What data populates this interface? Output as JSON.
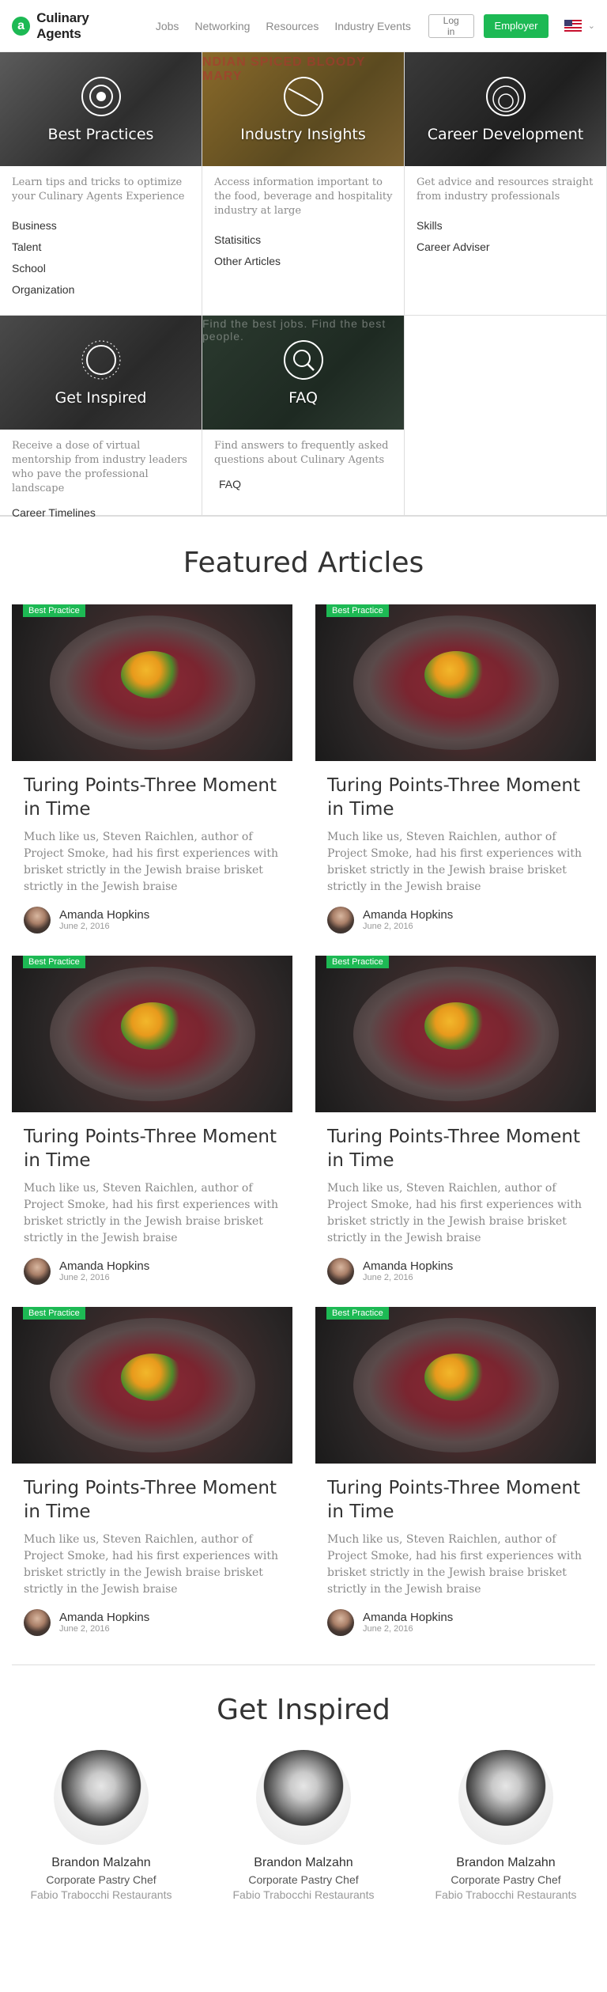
{
  "header": {
    "logo_text": "Culinary Agents",
    "nav": [
      "Jobs",
      "Networking",
      "Resources",
      "Industry Events"
    ],
    "login_label": "Log in",
    "employer_label": "Employer",
    "accent_color": "#1db954"
  },
  "categories": [
    {
      "title": "Best Practices",
      "tile_text": "",
      "description": "Learn tips and tricks to optimize your Culinary Agents Experience",
      "links": [
        "Business",
        "Talent",
        "School",
        "Organization"
      ]
    },
    {
      "title": "Industry Insights",
      "tile_text": "NDIAN SPICED   BLOODY MARY",
      "description": "Access information important to the food, beverage and hospitality industry at large",
      "links": [
        "Statisitics",
        "Other Articles"
      ]
    },
    {
      "title": "Career Development",
      "tile_text": "",
      "description": "Get advice and resources straight from industry professionals",
      "links": [
        "Skills",
        "Career Adviser"
      ]
    },
    {
      "title": "Get Inspired",
      "tile_text": "",
      "description": "Receive a dose of virtual mentorship from industry leaders who pave the professional landscape",
      "links": [
        "Career Timelines"
      ]
    },
    {
      "title": "FAQ",
      "tile_text": "Find the best jobs. Find the best people.",
      "description": "Find answers to frequently asked questions about Culinary Agents",
      "links": [
        "FAQ"
      ]
    }
  ],
  "featured": {
    "title": "Featured Articles",
    "articles": [
      {
        "badge": "Best Practice",
        "title": "Turing Points-Three Moment in Time",
        "body": "Much like us, Steven Raichlen, author of Project Smoke, had his first experiences with brisket strictly in the Jewish braise brisket strictly in the Jewish braise",
        "author": "Amanda Hopkins",
        "date": "June 2, 2016"
      },
      {
        "badge": "Best Practice",
        "title": "Turing Points-Three Moment in Time",
        "body": "Much like us, Steven Raichlen, author of Project Smoke, had his first experiences with brisket strictly in the Jewish braise brisket strictly in the Jewish braise",
        "author": "Amanda Hopkins",
        "date": "June 2, 2016"
      },
      {
        "badge": "Best Practice",
        "title": "Turing Points-Three Moment in Time",
        "body": "Much like us, Steven Raichlen, author of Project Smoke, had his first experiences with brisket strictly in the Jewish braise brisket strictly in the Jewish braise",
        "author": "Amanda Hopkins",
        "date": "June 2, 2016"
      },
      {
        "badge": "Best Practice",
        "title": "Turing Points-Three Moment in Time",
        "body": "Much like us, Steven Raichlen, author of Project Smoke, had his first experiences with brisket strictly in the Jewish braise brisket strictly in the Jewish braise",
        "author": "Amanda Hopkins",
        "date": "June 2, 2016"
      },
      {
        "badge": "Best Practice",
        "title": "Turing Points-Three Moment in Time",
        "body": "Much like us, Steven Raichlen, author of Project Smoke, had his first experiences with brisket strictly in the Jewish braise brisket strictly in the Jewish braise",
        "author": "Amanda Hopkins",
        "date": "June 2, 2016"
      },
      {
        "badge": "Best Practice",
        "title": "Turing Points-Three Moment in Time",
        "body": "Much like us, Steven Raichlen, author of Project Smoke, had his first experiences with brisket strictly in the Jewish braise brisket strictly in the Jewish braise",
        "author": "Amanda Hopkins",
        "date": "June 2, 2016"
      }
    ]
  },
  "inspired": {
    "title": "Get Inspired",
    "people": [
      {
        "name": "Brandon Malzahn",
        "role": "Corporate Pastry Chef",
        "org": "Fabio Trabocchi Restaurants"
      },
      {
        "name": "Brandon Malzahn",
        "role": "Corporate Pastry Chef",
        "org": "Fabio Trabocchi Restaurants"
      },
      {
        "name": "Brandon Malzahn",
        "role": "Corporate Pastry Chef",
        "org": "Fabio Trabocchi Restaurants"
      }
    ]
  }
}
